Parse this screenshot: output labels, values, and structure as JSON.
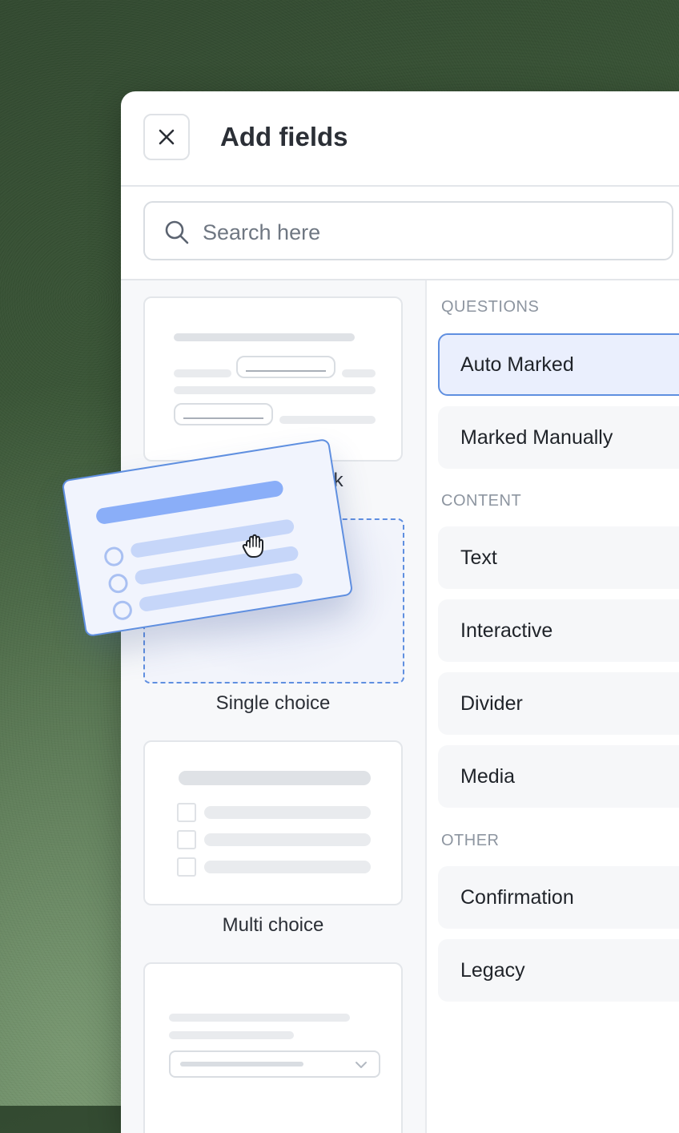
{
  "header": {
    "title": "Add fields"
  },
  "search": {
    "placeholder": "Search here"
  },
  "field_types": [
    {
      "label": "Fill in the blank",
      "visible_label": "nk"
    },
    {
      "label": "Single choice"
    },
    {
      "label": "Multi choice"
    }
  ],
  "sections": {
    "questions": {
      "title": "QUESTIONS",
      "items": [
        "Auto Marked",
        "Marked Manually"
      ]
    },
    "content": {
      "title": "CONTENT",
      "items": [
        "Text",
        "Interactive",
        "Divider",
        "Media"
      ]
    },
    "other": {
      "title": "OTHER",
      "items": [
        "Confirmation",
        "Legacy"
      ]
    }
  },
  "colors": {
    "accent": "#5f8fe0",
    "active_bg": "#eaeffd",
    "background": "#3e5b3a"
  }
}
